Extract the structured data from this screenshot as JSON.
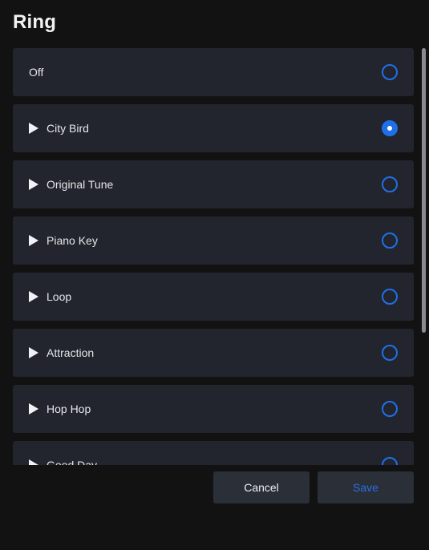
{
  "dialog": {
    "title": "Ring"
  },
  "options": [
    {
      "label": "Off",
      "has_play": false,
      "selected": false
    },
    {
      "label": "City Bird",
      "has_play": true,
      "selected": true
    },
    {
      "label": "Original Tune",
      "has_play": true,
      "selected": false
    },
    {
      "label": "Piano Key",
      "has_play": true,
      "selected": false
    },
    {
      "label": "Loop",
      "has_play": true,
      "selected": false
    },
    {
      "label": "Attraction",
      "has_play": true,
      "selected": false
    },
    {
      "label": "Hop Hop",
      "has_play": true,
      "selected": false
    },
    {
      "label": "Good Day",
      "has_play": true,
      "selected": false
    }
  ],
  "buttons": {
    "cancel_label": "Cancel",
    "save_label": "Save"
  },
  "colors": {
    "accent": "#1f6fe8",
    "background": "#121212",
    "item_background": "#22252d",
    "button_background": "#2b2f38"
  }
}
